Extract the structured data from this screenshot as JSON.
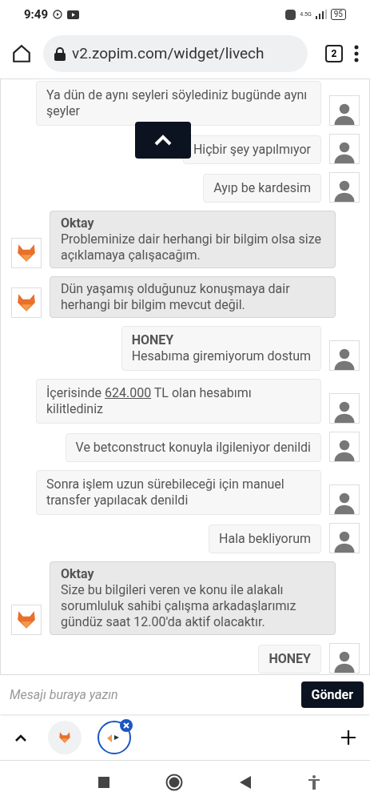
{
  "status_bar": {
    "time": "9:49",
    "battery": "95",
    "network": "4.5G"
  },
  "address_bar": {
    "url": "v2.zopim.com/widget/livech",
    "tab_count": "2"
  },
  "messages": [
    {
      "kind": "visitor",
      "segments": [
        {
          "kind": "plain",
          "text": "Ya dün de aynı seyleri söylediniz bugünde aynı şeyler"
        }
      ]
    },
    {
      "kind": "visitor",
      "segments": [
        {
          "kind": "plain",
          "text": "Hiçbir şey yapılmıyor"
        }
      ]
    },
    {
      "kind": "visitor",
      "segments": [
        {
          "kind": "plain",
          "text": "Ayıp be kardesim"
        }
      ]
    },
    {
      "kind": "agent",
      "name": "Oktay",
      "segments": [
        {
          "kind": "plain",
          "text": "Probleminize dair herhangi bir bilgim olsa size açıklamaya çalışacağım."
        }
      ]
    },
    {
      "kind": "agent",
      "segments": [
        {
          "kind": "plain",
          "text": "Dün yaşamış olduğunuz konuşmaya dair herhangi bir bilgim mevcut değil."
        }
      ]
    },
    {
      "kind": "visitor",
      "name": "HONEY",
      "segments": [
        {
          "kind": "plain",
          "text": "Hesabıma giremiyorum dostum"
        }
      ]
    },
    {
      "kind": "visitor",
      "segments": [
        {
          "kind": "plain",
          "text": "İçerisinde "
        },
        {
          "kind": "link",
          "text": "624.000"
        },
        {
          "kind": "plain",
          "text": " TL olan hesabımı kilitlediniz"
        }
      ]
    },
    {
      "kind": "visitor",
      "segments": [
        {
          "kind": "plain",
          "text": "Ve betconstruct konuyla ilgileniyor denildi"
        }
      ]
    },
    {
      "kind": "visitor",
      "segments": [
        {
          "kind": "plain",
          "text": "Sonra işlem uzun sürebileceği için manuel transfer yapılacak denildi"
        }
      ]
    },
    {
      "kind": "visitor",
      "segments": [
        {
          "kind": "plain",
          "text": "Hala bekliyorum"
        }
      ]
    },
    {
      "kind": "agent",
      "name": "Oktay",
      "segments": [
        {
          "kind": "plain",
          "text": "Size bu bilgileri veren ve konu ile alakalı sorumluluk sahibi çalışma arkadaşlarımız gündüz saat 12.00'da aktif olacaktır."
        }
      ]
    },
    {
      "kind": "visitor",
      "name": "HONEY"
    }
  ],
  "composer": {
    "placeholder": "Mesajı buraya yazın",
    "send": "Gönder"
  },
  "tabs": [
    {
      "kind": "fox",
      "selected": false
    },
    {
      "kind": "site",
      "selected": true
    }
  ]
}
